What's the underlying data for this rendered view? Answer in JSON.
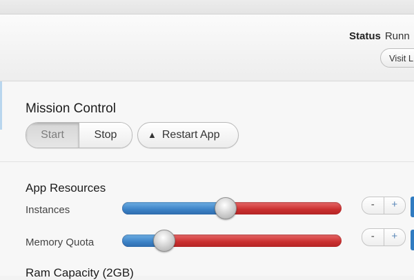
{
  "header": {
    "status_label": "Status",
    "status_value": "Runn",
    "visit_button": "Visit L"
  },
  "mission_control": {
    "title": "Mission Control",
    "start_label": "Start",
    "stop_label": "Stop",
    "restart_label": "Restart App",
    "restart_icon": "warning-icon"
  },
  "app_resources": {
    "title": "App Resources",
    "instances": {
      "label": "Instances",
      "level": 0.47,
      "minus": "-",
      "plus": "+"
    },
    "memory_quota": {
      "label": "Memory Quota",
      "level": 0.19,
      "minus": "-",
      "plus": "+"
    }
  },
  "ram_capacity": {
    "title": "Ram Capacity (2GB)"
  },
  "colors": {
    "slider_fill": "#3c82c6",
    "slider_track": "#c92f2f",
    "accent": "#2f7bc1"
  }
}
